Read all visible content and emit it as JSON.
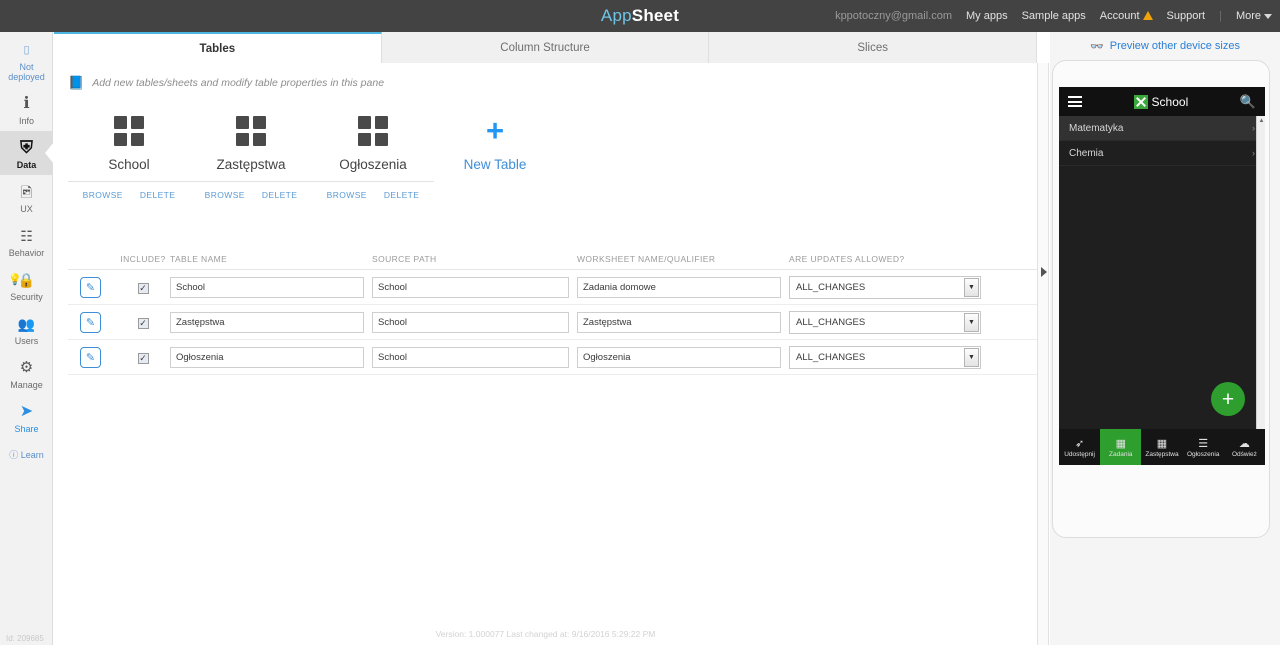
{
  "topbar": {
    "brand_prefix": "App",
    "brand_suffix": "Sheet",
    "email": "kppotoczny@gmail.com",
    "nav": [
      {
        "label": "My apps"
      },
      {
        "label": "Sample apps"
      },
      {
        "label": "Account",
        "warning": true
      },
      {
        "label": "Support"
      },
      {
        "label": "More",
        "caret": true
      }
    ],
    "separator": "|"
  },
  "sidebar": {
    "deploy_status": "Not deployed",
    "deploy_icon": "monitor-icon",
    "items": [
      {
        "label": "Info",
        "icon": "info-icon",
        "glyph": "ℹ",
        "active": false
      },
      {
        "label": "Data",
        "icon": "data-icon",
        "glyph": "☸",
        "active": true
      },
      {
        "label": "UX",
        "icon": "ux-icon",
        "glyph": "Ὓc",
        "active": false
      },
      {
        "label": "Behavior",
        "icon": "behavior-icon",
        "glyph": "⛓",
        "active": false
      },
      {
        "label": "Security",
        "icon": "lock-icon",
        "glyph": "🔒",
        "active": false,
        "bulb": true
      },
      {
        "label": "Users",
        "icon": "users-icon",
        "glyph": "👥",
        "active": false
      },
      {
        "label": "Manage",
        "icon": "manage-icon",
        "glyph": "⚙",
        "active": false
      },
      {
        "label": "Share",
        "icon": "share-icon",
        "glyph": "➤",
        "active": false
      }
    ],
    "learn": {
      "label": "Learn",
      "icon": "help-icon"
    },
    "app_id": "Id: 209685"
  },
  "tabs": [
    {
      "label": "Tables",
      "active": true
    },
    {
      "label": "Column Structure",
      "active": false
    },
    {
      "label": "Slices",
      "active": false
    }
  ],
  "main": {
    "hint": "Add new tables/sheets and modify table properties in this pane",
    "hint_icon": "book-icon",
    "cards": [
      {
        "name": "School",
        "browse": "BROWSE",
        "delete": "DELETE"
      },
      {
        "name": "Zastępstwa",
        "browse": "BROWSE",
        "delete": "DELETE"
      },
      {
        "name": "Ogłoszenia",
        "browse": "BROWSE",
        "delete": "DELETE"
      }
    ],
    "new_table": {
      "label": "New Table",
      "icon": "plus-icon"
    },
    "grid": {
      "headers": {
        "include": "INCLUDE?",
        "table_name": "TABLE NAME",
        "source_path": "SOURCE PATH",
        "worksheet": "WORKSHEET NAME/QUALIFIER",
        "updates": "ARE UPDATES ALLOWED?"
      },
      "rows": [
        {
          "include": true,
          "table_name": "School",
          "source_path": "School",
          "worksheet": "Zadania domowe",
          "updates": "ALL_CHANGES"
        },
        {
          "include": true,
          "table_name": "Zastępstwa",
          "source_path": "School",
          "worksheet": "Zastępstwa",
          "updates": "ALL_CHANGES"
        },
        {
          "include": true,
          "table_name": "Ogłoszenia",
          "source_path": "School",
          "worksheet": "Ogłoszenia",
          "updates": "ALL_CHANGES"
        }
      ]
    },
    "footer": "Version: 1.000077 Last changed at: 9/16/2016 5:29:22 PM"
  },
  "preview": {
    "link_label": "Preview other device sizes",
    "link_icon": "binoculars-icon",
    "phone": {
      "app_title": "School",
      "menu_icon": "hamburger-icon",
      "search_icon": "search-icon",
      "list": [
        {
          "label": "Matematyka",
          "selected": true
        },
        {
          "label": "Chemia",
          "selected": false
        }
      ],
      "fab_icon": "plus-icon",
      "nav": [
        {
          "label": "Udostępnij",
          "icon": "share-arrow-icon",
          "glyph": "➦",
          "active": false
        },
        {
          "label": "Zadania",
          "icon": "grid-table-icon",
          "glyph": "▦",
          "active": true
        },
        {
          "label": "Zastępstwa",
          "icon": "grid-table-icon",
          "glyph": "▦",
          "active": false
        },
        {
          "label": "Ogłoszenia",
          "icon": "list-icon",
          "glyph": "☰",
          "active": false
        },
        {
          "label": "Odśwież",
          "icon": "cloud-icon",
          "glyph": "☁",
          "active": false
        }
      ]
    }
  },
  "colors": {
    "topbar_bg": "#434343",
    "accent_blue": "#2a7fd4",
    "tab_active_underline": "#4cb6e0",
    "phone_green": "#2e9e2e",
    "warning_orange": "#f0a30a"
  }
}
